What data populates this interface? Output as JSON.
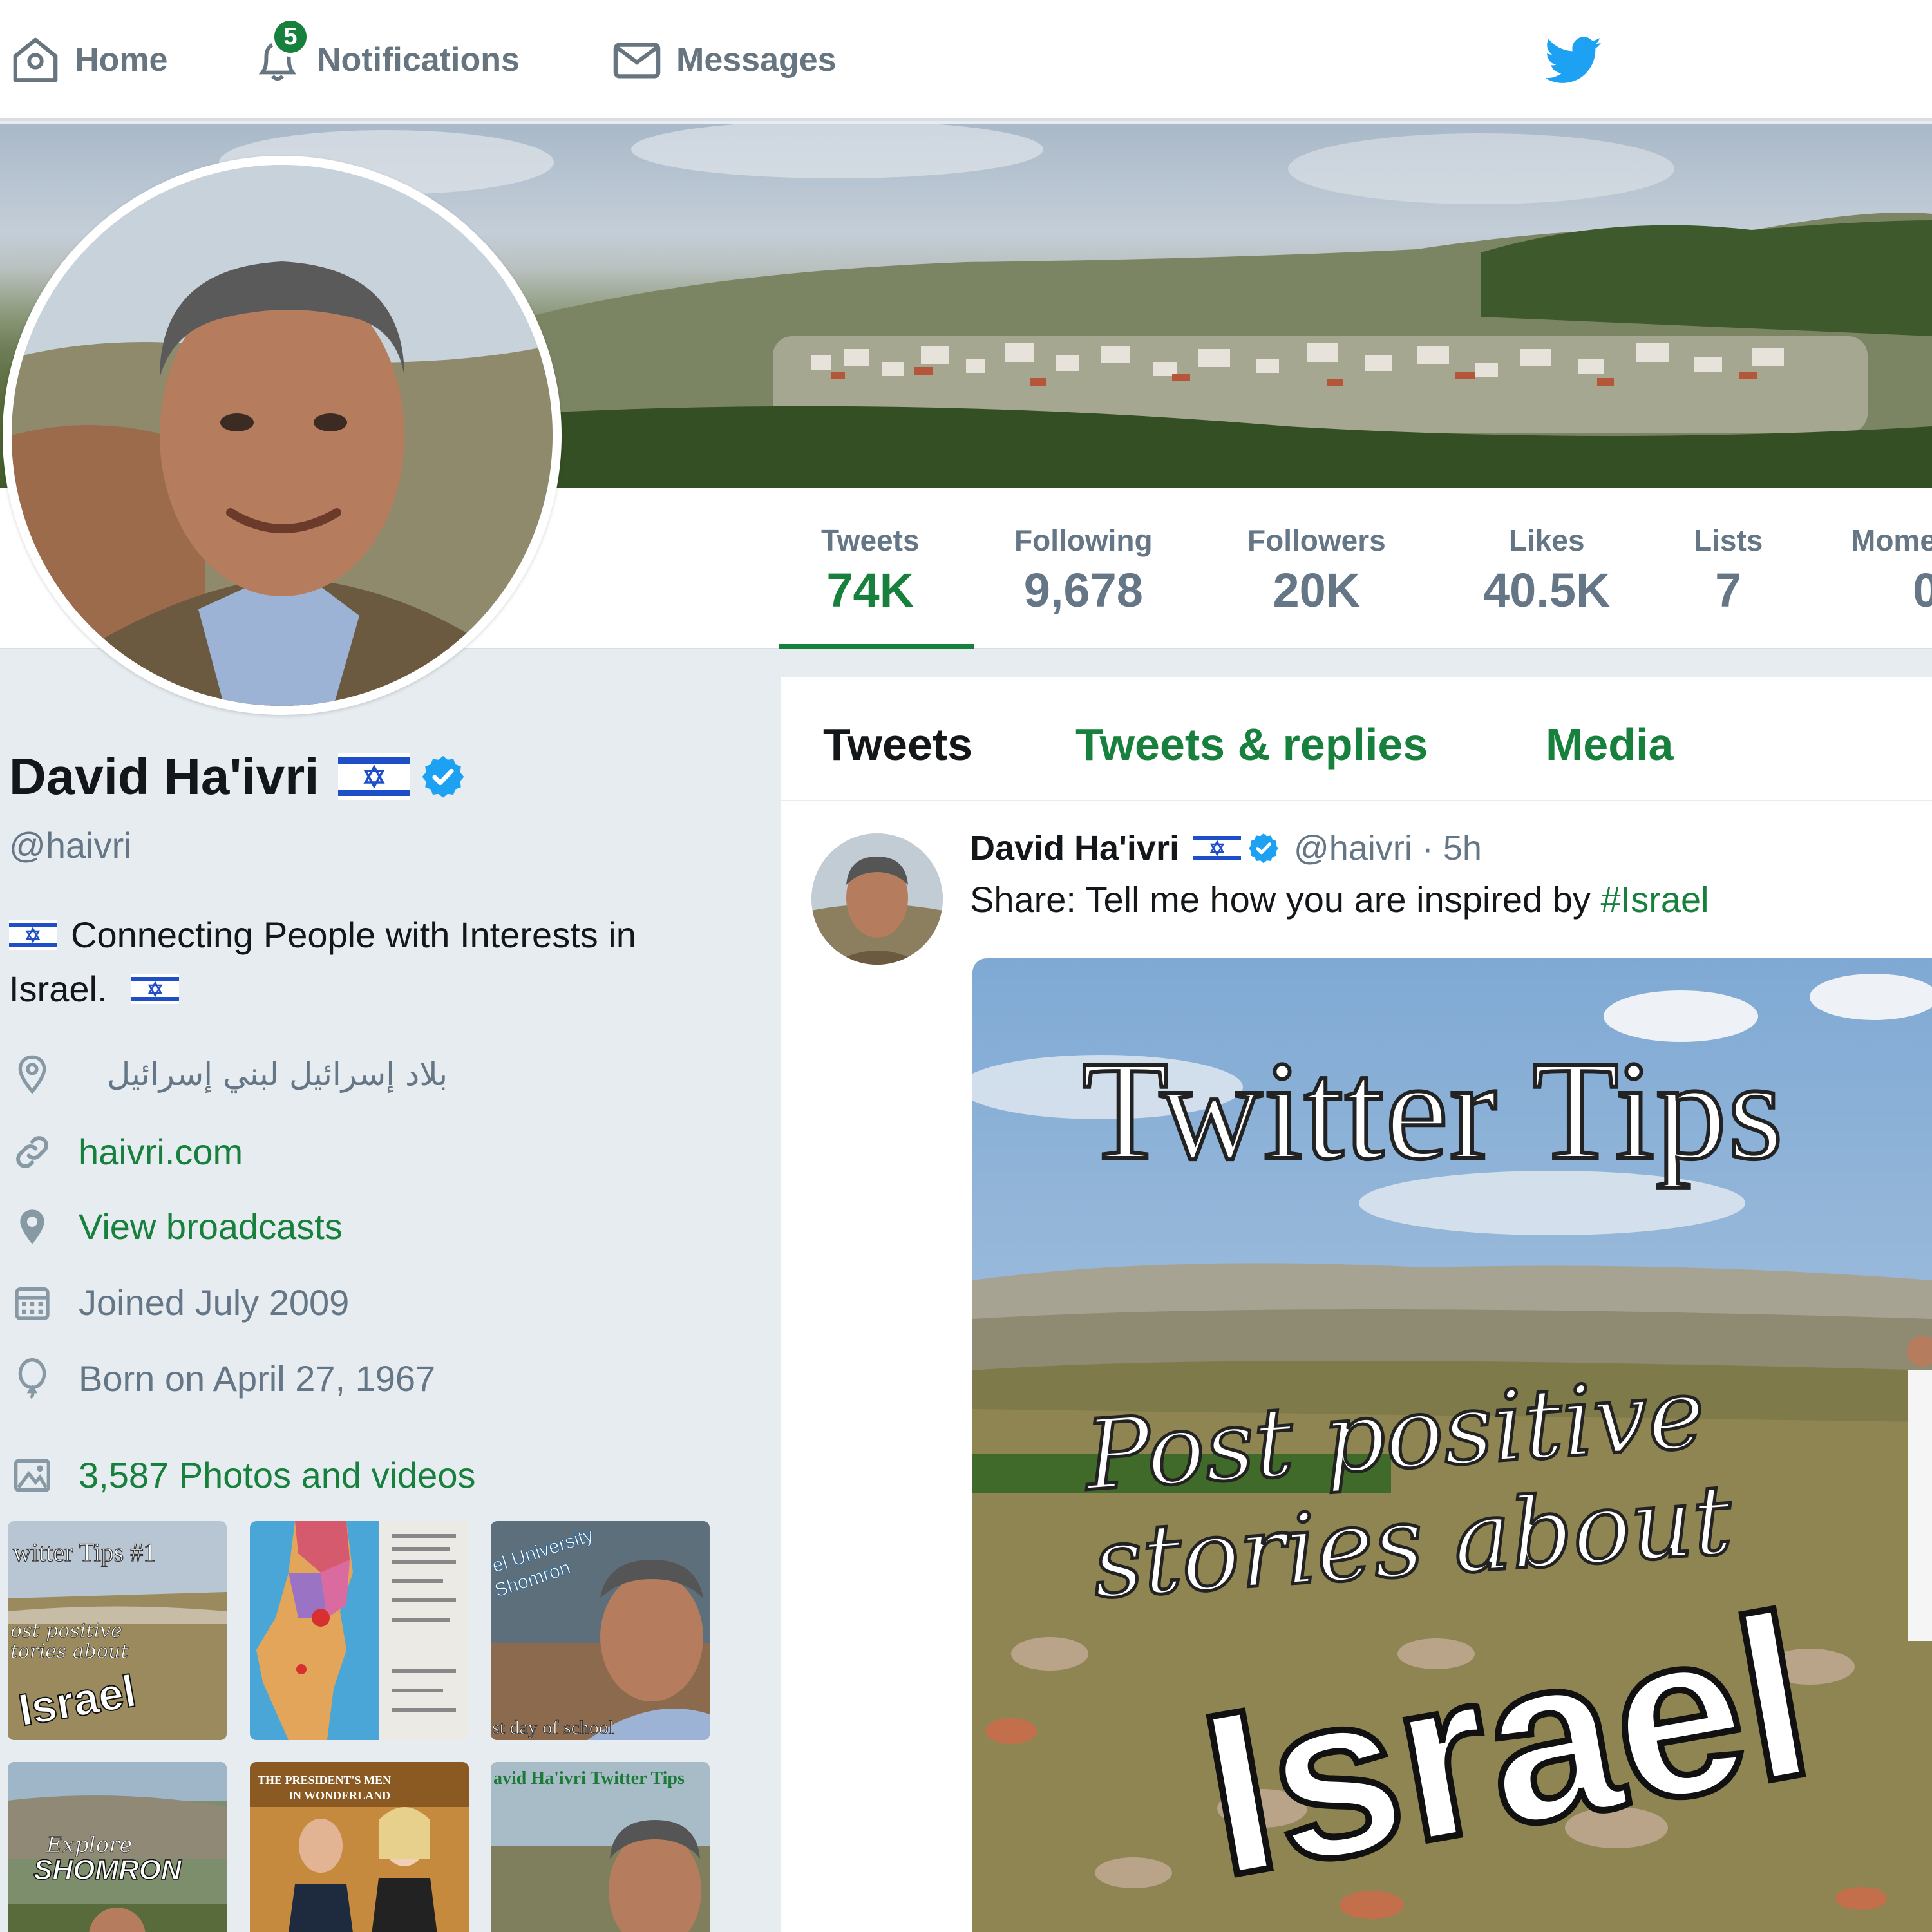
{
  "nav": {
    "home_label": "Home",
    "notifications_label": "Notifications",
    "notifications_count": "5",
    "messages_label": "Messages"
  },
  "stats": [
    {
      "label": "Tweets",
      "value": "74K",
      "active": true
    },
    {
      "label": "Following",
      "value": "9,678"
    },
    {
      "label": "Followers",
      "value": "20K"
    },
    {
      "label": "Likes",
      "value": "40.5K"
    },
    {
      "label": "Lists",
      "value": "7"
    },
    {
      "label": "Mome",
      "value": "0"
    }
  ],
  "profile": {
    "name": "David Ha'ivri",
    "handle": "@haivri",
    "bio": "Connecting People with Interests in Israel.",
    "location": "بلاد إسرائيل لبني إسرائيل",
    "website": "haivri.com",
    "broadcasts": "View broadcasts",
    "joined": "Joined July 2009",
    "born": "Born on April 27, 1967",
    "photos_videos": "3,587 Photos and videos"
  },
  "thumbnails": [
    {
      "caption": "witter Tips #1",
      "caption2": "ost positive",
      "caption3": "tories about",
      "caption4": "Israel"
    },
    {
      "caption": ""
    },
    {
      "caption": "el University",
      "caption2": "Shomron",
      "caption3": "st day of school"
    },
    {
      "caption": "Explore",
      "caption2": "SHOMRON"
    },
    {
      "caption": "THE PRESIDENT'S MEN",
      "caption2": "IN WONDERLAND"
    },
    {
      "caption": "avid Ha'ivri Twitter Tips"
    }
  ],
  "timeline": {
    "tabs": [
      "Tweets",
      "Tweets & replies",
      "Media"
    ],
    "tweet": {
      "author": "David Ha'ivri",
      "handle_time": "@haivri · 5h",
      "text": "Share: Tell me how you are inspired by ",
      "hashtag": "#Israel",
      "media_title": "Twitter Tips",
      "media_sub1": "Post positive",
      "media_sub2": "stories about",
      "media_big": "Israel"
    }
  },
  "colors": {
    "accent": "#17803c",
    "verified": "#1da1f2",
    "twitter_blue": "#1da1f2",
    "text_muted": "#657786",
    "background": "#e6ecf0"
  },
  "icons": [
    "home-icon",
    "bell-icon",
    "envelope-icon",
    "twitter-bird-icon",
    "verified-icon",
    "location-icon",
    "link-icon",
    "broadcast-pin-icon",
    "calendar-icon",
    "balloon-icon",
    "photo-icon"
  ]
}
